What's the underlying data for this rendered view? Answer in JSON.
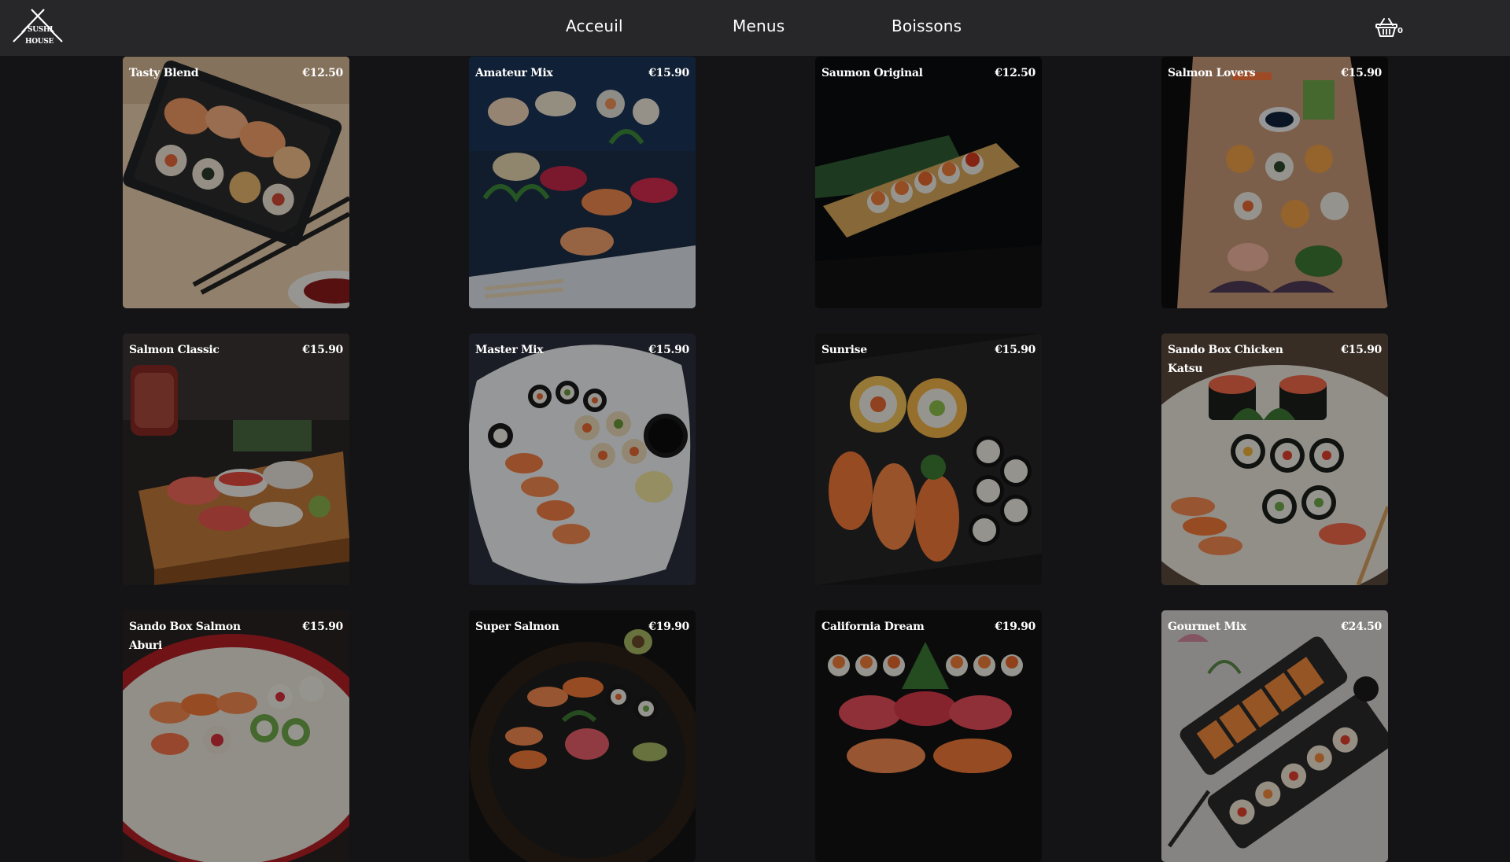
{
  "header": {
    "logo_text_line1": "SUSHI",
    "logo_text_line2": "HOUSE",
    "nav": [
      {
        "label": "Acceuil"
      },
      {
        "label": "Menus"
      },
      {
        "label": "Boissons"
      }
    ],
    "cart_count": "0"
  },
  "products": [
    {
      "name": "Tasty Blend",
      "price": "€12.50"
    },
    {
      "name": "Amateur Mix",
      "price": "€15.90"
    },
    {
      "name": "Saumon Original",
      "price": "€12.50"
    },
    {
      "name": "Salmon Lovers",
      "price": "€15.90"
    },
    {
      "name": "Salmon Classic",
      "price": "€15.90"
    },
    {
      "name": "Master Mix",
      "price": "€15.90"
    },
    {
      "name": "Sunrise",
      "price": "€15.90"
    },
    {
      "name": "Sando Box Chicken Katsu",
      "price": "€15.90"
    },
    {
      "name": "Sando Box Salmon Aburi",
      "price": "€15.90"
    },
    {
      "name": "Super Salmon",
      "price": "€19.90"
    },
    {
      "name": "California Dream",
      "price": "€19.90"
    },
    {
      "name": "Gourmet Mix",
      "price": "€24.50"
    }
  ],
  "colors": {
    "page_background": "#141416",
    "navbar_background": "#27272a",
    "text": "#ffffff"
  }
}
